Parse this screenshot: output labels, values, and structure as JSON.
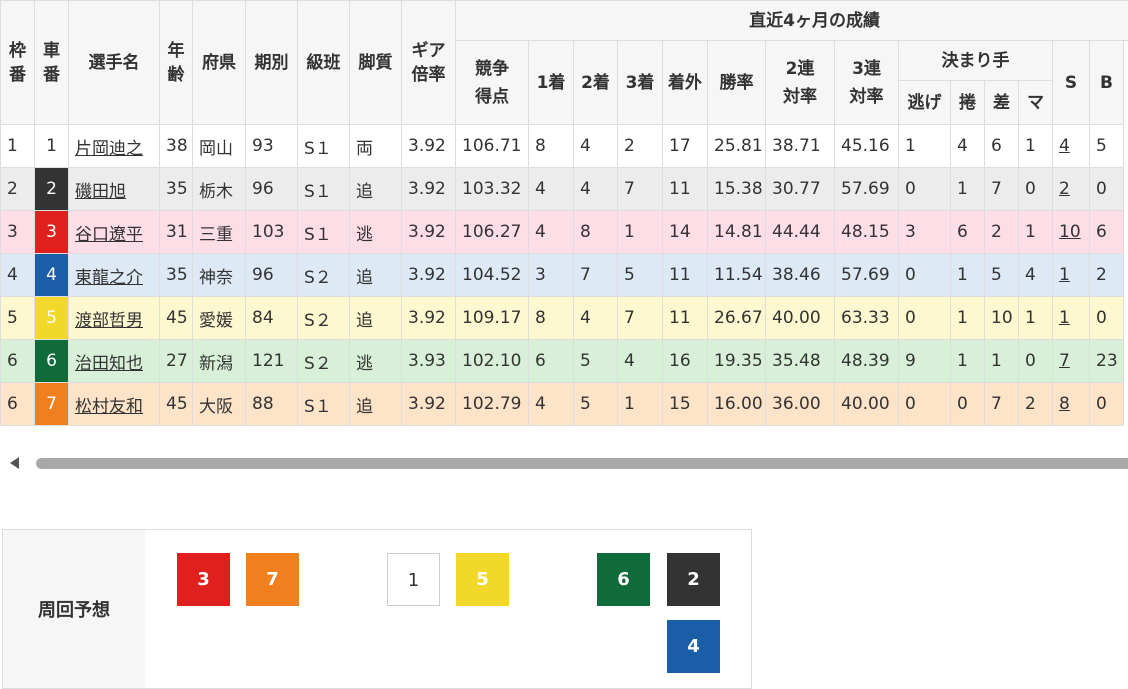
{
  "colors": {
    "car_1": "#ffffff",
    "car_2": "#333333",
    "car_3": "#e0201e",
    "car_4": "#1a5ea8",
    "car_5": "#f1d82b",
    "car_6": "#0f6b3a",
    "car_7": "#f07f1e"
  },
  "header": {
    "waku": "枠番",
    "car": "車番",
    "name": "選手名",
    "age": "年齢",
    "pref": "府県",
    "term": "期別",
    "class": "級班",
    "style": "脚質",
    "gear": "ギア倍率",
    "recent": "直近4ヶ月の成績",
    "score": "競争得点",
    "first": "1着",
    "second": "2着",
    "third": "3着",
    "out": "着外",
    "win_rate": "勝率",
    "rate2": "2連対率",
    "rate3": "3連対率",
    "kimarite": "決まり手",
    "nige": "逃げ",
    "makuri": "捲",
    "sashi": "差",
    "ma": "マ",
    "s": "S",
    "b": "B"
  },
  "rows": [
    {
      "waku": "1",
      "car": "1",
      "name": "片岡迪之",
      "age": "38",
      "pref": "岡山",
      "term": "93",
      "class": "S１",
      "style": "両",
      "gear": "3.92",
      "score": "106.71",
      "first": "8",
      "second": "4",
      "third": "2",
      "out": "17",
      "win": "25.81",
      "r2": "38.71",
      "r3": "45.16",
      "nige": "1",
      "makuri": "4",
      "sashi": "6",
      "ma": "1",
      "s": "4",
      "b": "5"
    },
    {
      "waku": "2",
      "car": "2",
      "name": "磯田旭",
      "age": "35",
      "pref": "栃木",
      "term": "96",
      "class": "S１",
      "style": "追",
      "gear": "3.92",
      "score": "103.32",
      "first": "4",
      "second": "4",
      "third": "7",
      "out": "11",
      "win": "15.38",
      "r2": "30.77",
      "r3": "57.69",
      "nige": "0",
      "makuri": "1",
      "sashi": "7",
      "ma": "0",
      "s": "2",
      "b": "0"
    },
    {
      "waku": "3",
      "car": "3",
      "name": "谷口遼平",
      "age": "31",
      "pref": "三重",
      "term": "103",
      "class": "S１",
      "style": "逃",
      "gear": "3.92",
      "score": "106.27",
      "first": "4",
      "second": "8",
      "third": "1",
      "out": "14",
      "win": "14.81",
      "r2": "44.44",
      "r3": "48.15",
      "nige": "3",
      "makuri": "6",
      "sashi": "2",
      "ma": "1",
      "s": "10",
      "b": "6"
    },
    {
      "waku": "4",
      "car": "4",
      "name": "東龍之介",
      "age": "35",
      "pref": "神奈",
      "term": "96",
      "class": "S２",
      "style": "追",
      "gear": "3.92",
      "score": "104.52",
      "first": "3",
      "second": "7",
      "third": "5",
      "out": "11",
      "win": "11.54",
      "r2": "38.46",
      "r3": "57.69",
      "nige": "0",
      "makuri": "1",
      "sashi": "5",
      "ma": "4",
      "s": "1",
      "b": "2"
    },
    {
      "waku": "5",
      "car": "5",
      "name": "渡部哲男",
      "age": "45",
      "pref": "愛媛",
      "term": "84",
      "class": "S２",
      "style": "追",
      "gear": "3.92",
      "score": "109.17",
      "first": "8",
      "second": "4",
      "third": "7",
      "out": "11",
      "win": "26.67",
      "r2": "40.00",
      "r3": "63.33",
      "nige": "0",
      "makuri": "1",
      "sashi": "10",
      "ma": "1",
      "s": "1",
      "b": "0"
    },
    {
      "waku": "6",
      "car": "6",
      "name": "治田知也",
      "age": "27",
      "pref": "新潟",
      "term": "121",
      "class": "S２",
      "style": "逃",
      "gear": "3.93",
      "score": "102.10",
      "first": "6",
      "second": "5",
      "third": "4",
      "out": "16",
      "win": "19.35",
      "r2": "35.48",
      "r3": "48.39",
      "nige": "9",
      "makuri": "1",
      "sashi": "1",
      "ma": "0",
      "s": "7",
      "b": "23"
    },
    {
      "waku": "6",
      "car": "7",
      "name": "松村友和",
      "age": "45",
      "pref": "大阪",
      "term": "88",
      "class": "S１",
      "style": "追",
      "gear": "3.92",
      "score": "102.79",
      "first": "4",
      "second": "5",
      "third": "1",
      "out": "15",
      "win": "16.00",
      "r2": "36.00",
      "r3": "40.00",
      "nige": "0",
      "makuri": "0",
      "sashi": "7",
      "ma": "2",
      "s": "8",
      "b": "0"
    }
  ],
  "prediction": {
    "label": "周回予想",
    "chips": [
      "3",
      "7",
      "1",
      "5",
      "6",
      "2",
      "4"
    ]
  }
}
